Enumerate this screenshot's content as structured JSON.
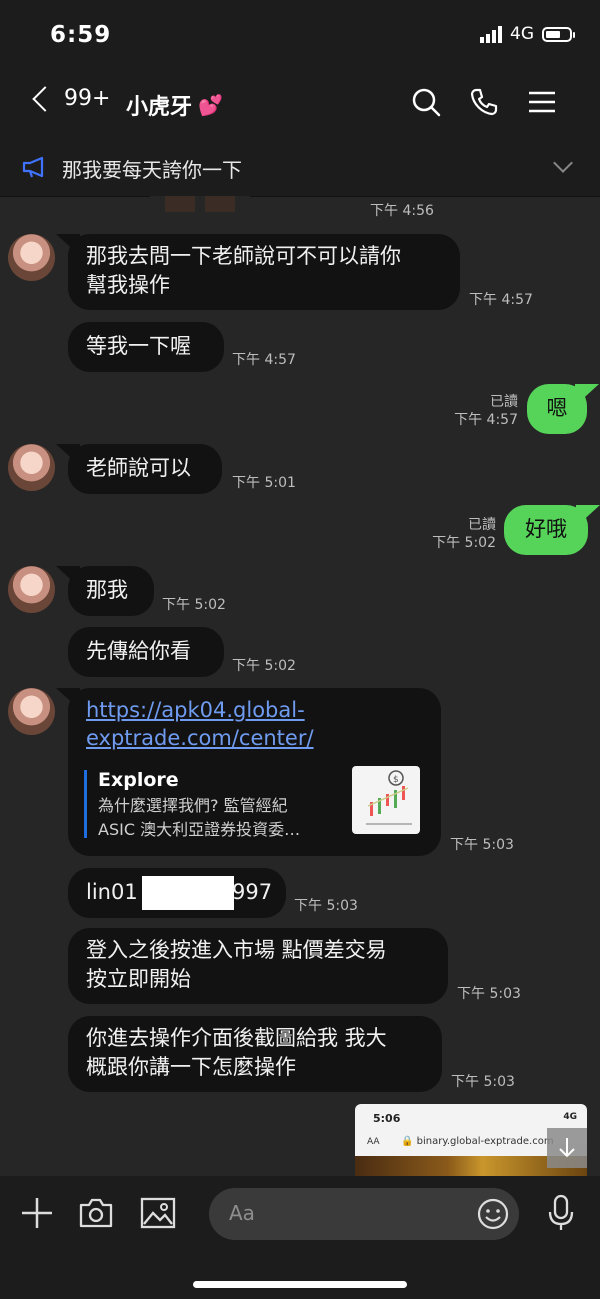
{
  "status_bar": {
    "time": "6:59",
    "network": "4G"
  },
  "header": {
    "back_count": "99+",
    "contact_name": "小虎牙",
    "title_emoji": "💕"
  },
  "announcement": {
    "text": "那我要每天誇你一下"
  },
  "messages": [
    {
      "side": "them",
      "text": "",
      "time": "下午 4:56"
    },
    {
      "side": "them",
      "text_line1": "那我去問一下老師說可不可以請你",
      "text_line2": "幫我操作",
      "time": "下午 4:57"
    },
    {
      "side": "them",
      "text": "等我一下喔",
      "time": "下午 4:57"
    },
    {
      "side": "me",
      "text": "嗯",
      "read": "已讀",
      "time": "下午 4:57"
    },
    {
      "side": "them",
      "text": "老師說可以",
      "time": "下午 5:01"
    },
    {
      "side": "me",
      "text": "好哦",
      "read": "已讀",
      "time": "下午 5:02"
    },
    {
      "side": "them",
      "text": "那我",
      "time": "下午 5:02"
    },
    {
      "side": "them",
      "text": "先傳給你看",
      "time": "下午 5:02"
    },
    {
      "side": "them",
      "link_line1": "https://apk04.global-",
      "link_line2": "exptrade.com/center/",
      "preview_title": "Explore",
      "preview_line1": "為什麼選擇我們? 監管經紀",
      "preview_line2": "ASIC 澳大利亞證券投資委…",
      "time": "下午 5:03"
    },
    {
      "side": "them",
      "text_start": "lin01",
      "text_end": "997",
      "time": "下午 5:03"
    },
    {
      "side": "them",
      "text_line1": "登入之後按進入市場 點價差交易",
      "text_line2": "按立即開始",
      "time": "下午 5:03"
    },
    {
      "side": "them",
      "text_line1": "你進去操作介面後截圖給我 我大",
      "text_line2": "概跟你講一下怎麼操作",
      "time": "下午 5:03"
    },
    {
      "side": "me",
      "type": "image",
      "screenshot_time": "5:06",
      "screenshot_network": "4G",
      "screenshot_aa": "AA",
      "screenshot_url": "binary.global-exptrade.com"
    }
  ],
  "input": {
    "placeholder": "Aa"
  }
}
